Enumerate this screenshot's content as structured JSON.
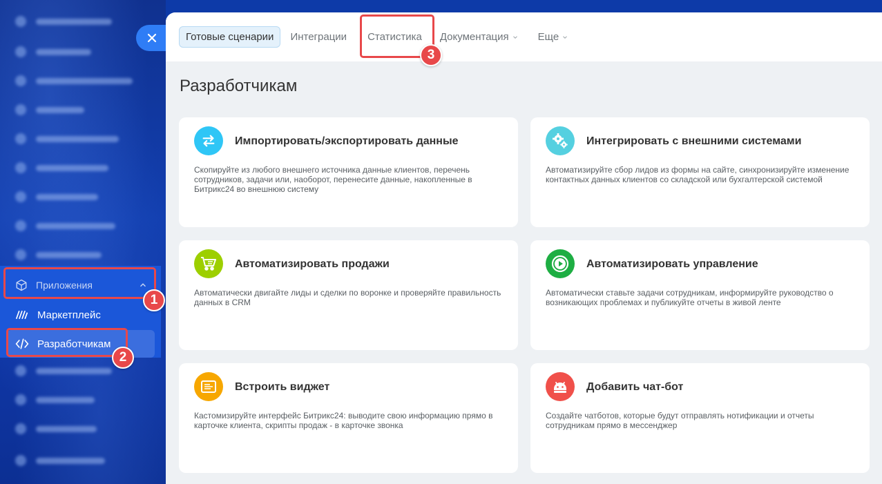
{
  "sidebar": {
    "apps_label": "Приложения",
    "marketplace_label": "Маркетплейс",
    "developers_label": "Разработчикам"
  },
  "badges": {
    "one": "1",
    "two": "2",
    "three": "3"
  },
  "tabs": [
    {
      "label": "Готовые сценарии",
      "active": true
    },
    {
      "label": "Интеграции"
    },
    {
      "label": "Статистика"
    },
    {
      "label": "Документация",
      "caret": "⌄"
    },
    {
      "label": "Еще",
      "caret": "⌄"
    }
  ],
  "page_title": "Разработчикам",
  "cards": [
    {
      "title": "Импортировать/экспортировать данные",
      "description": "Скопируйте из любого внешнего источника данные клиентов, перечень сотрудников, задачи или, наоборот, перенесите данные, накопленные в Битрикс24 во внешнюю систему",
      "icon": "arrows-exchange-icon",
      "color": "#2fc6f6"
    },
    {
      "title": "Интегрировать с внешними системами",
      "description": "Автоматизируйте сбор лидов из формы на сайте, синхронизируйте изменение контактных данных клиентов со складской или бухгалтерской системой",
      "icon": "gears-icon",
      "color": "#55d0e0"
    },
    {
      "title": "Автоматизировать продажи",
      "description": "Автоматически двигайте лиды и сделки по воронке и проверяйте правильность данных в CRM",
      "icon": "cart-icon",
      "color": "#9dcf00"
    },
    {
      "title": "Автоматизировать управление",
      "description": "Автоматически ставьте задачи сотрудникам, информируйте руководство о возникающих проблемах и публикуйте отчеты в живой ленте",
      "icon": "play-icon",
      "color": "#1eae43"
    },
    {
      "title": "Встроить виджет",
      "description": "Кастомизируйте интерфейс Битрикс24: выводите свою информацию прямо в карточке клиента, скрипты продаж - в карточке звонка",
      "icon": "widget-icon",
      "color": "#f7a700"
    },
    {
      "title": "Добавить чат-бот",
      "description": "Создайте чатботов, которые будут отправлять нотификации и отчеты сотрудникам прямо в мессенджер",
      "icon": "android-icon",
      "color": "#f0504a"
    }
  ]
}
